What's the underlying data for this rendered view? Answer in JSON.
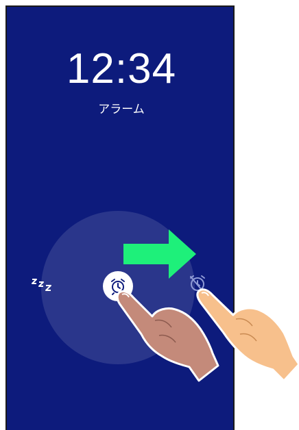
{
  "lockscreen": {
    "time": "12:34",
    "alarm_label": "アラーム"
  },
  "icons": {
    "snooze": "snooze-zzz-icon",
    "alarm": "alarm-clock-icon",
    "dismiss": "alarm-off-icon",
    "arrow": "right-arrow-icon",
    "hands": "pointing-hand-icon"
  },
  "colors": {
    "background": "#0d1b7c",
    "arrow": "#1ef07a",
    "hand_dark": "#c48a7a",
    "hand_light": "#f7c08c"
  }
}
